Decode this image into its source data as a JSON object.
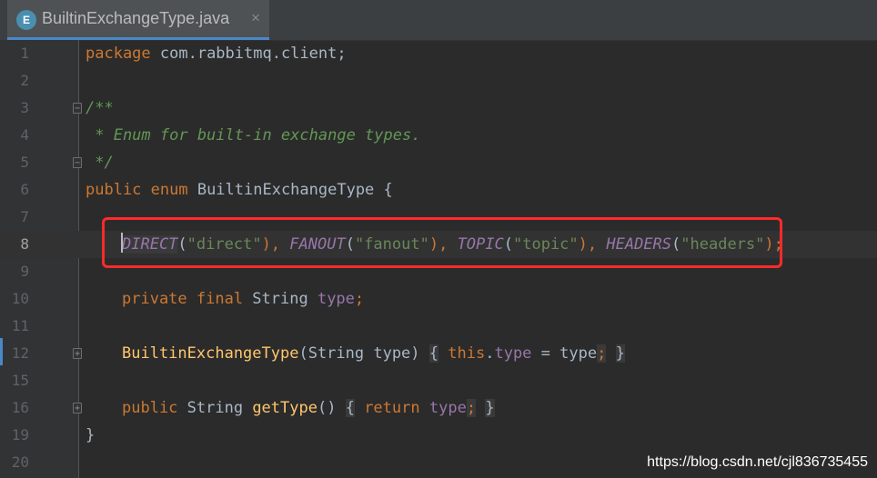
{
  "tab": {
    "icon_letter": "E",
    "filename": "BuiltinExchangeType.java",
    "close": "×"
  },
  "line_numbers": [
    "1",
    "2",
    "3",
    "4",
    "5",
    "6",
    "7",
    "8",
    "9",
    "10",
    "11",
    "12",
    "15",
    "16",
    "19",
    "20"
  ],
  "code": {
    "l1": [
      "package",
      " com.rabbitmq.client;"
    ],
    "l3": "/**",
    "l4": " * Enum for built-in exchange types.",
    "l5": " */",
    "l6": [
      "public enum",
      " BuiltinExchangeType {"
    ],
    "l8": [
      "DIRECT",
      "(",
      "\"direct\"",
      "), ",
      "FANOUT",
      "(",
      "\"fanout\"",
      "), ",
      "TOPIC",
      "(",
      "\"topic\"",
      "), ",
      "HEADERS",
      "(",
      "\"headers\"",
      ");"
    ],
    "l10": [
      "private final",
      " String ",
      "type",
      ";"
    ],
    "l12": [
      "BuiltinExchangeType",
      "(String type) ",
      "{",
      " ",
      "this",
      ".",
      "type",
      " = type",
      ";",
      " ",
      "}"
    ],
    "l16": [
      "public",
      " String ",
      "getType",
      "() ",
      "{",
      " ",
      "return",
      " ",
      "type",
      ";",
      " ",
      "}"
    ],
    "l19": "}"
  },
  "watermark": "https://blog.csdn.net/cjl836735455"
}
